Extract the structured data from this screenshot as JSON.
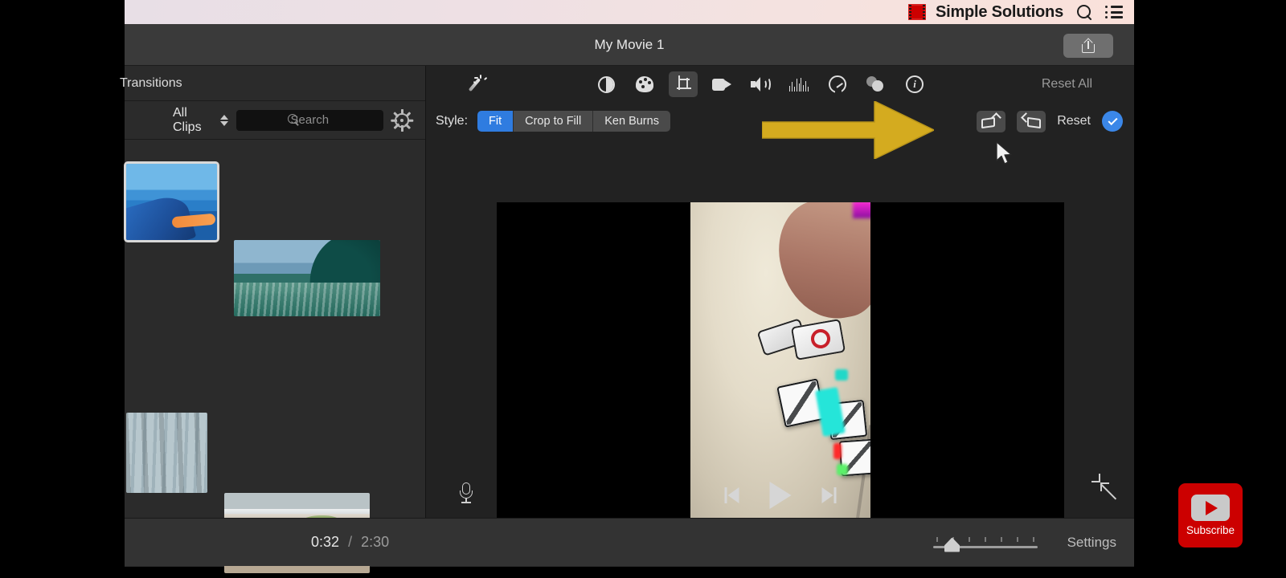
{
  "browser_bar": {
    "brand": "Simple Solutions",
    "logo_icon": "film-strip-icon",
    "search_icon": "search-icon",
    "menu_icon": "list-menu-icon"
  },
  "window": {
    "title": "My Movie 1",
    "share_icon": "share-upload-icon"
  },
  "library": {
    "header_title": "Transitions",
    "filter_label": "All Clips",
    "filter_stepper_icon": "up-down-chevron-icon",
    "search_placeholder": "Search",
    "search_value": "",
    "search_icon": "search-icon",
    "settings_icon": "gear-icon",
    "clips": [
      {
        "name": "clip-kayak",
        "selected": true
      },
      {
        "name": "clip-surf-wave",
        "selected": false
      },
      {
        "name": "clip-water-ripples",
        "selected": false
      },
      {
        "name": "clip-beach-rock",
        "selected": false
      }
    ]
  },
  "inspector": {
    "tools": [
      {
        "name": "enhance-magic-wand",
        "icon": "magic-wand-icon",
        "active": false
      },
      {
        "name": "color-balance",
        "icon": "half-circle-icon",
        "active": false
      },
      {
        "name": "color-correction",
        "icon": "palette-icon",
        "active": false
      },
      {
        "name": "cropping",
        "icon": "crop-icon",
        "active": true
      },
      {
        "name": "stabilization",
        "icon": "video-camera-icon",
        "active": false
      },
      {
        "name": "volume",
        "icon": "speaker-icon",
        "active": false
      },
      {
        "name": "noise-reduction-equalizer",
        "icon": "equalizer-icon",
        "active": false
      },
      {
        "name": "speed",
        "icon": "speedometer-icon",
        "active": false
      },
      {
        "name": "clip-filter",
        "icon": "overlapping-circles-icon",
        "active": false
      },
      {
        "name": "info",
        "icon": "info-circle-icon",
        "active": false
      }
    ],
    "reset_all_label": "Reset All",
    "style_label": "Style:",
    "style_options": [
      {
        "label": "Fit",
        "selected": true
      },
      {
        "label": "Crop to Fill",
        "selected": false
      },
      {
        "label": "Ken Burns",
        "selected": false
      }
    ],
    "rotate_ccw_icon": "rotate-counterclockwise-icon",
    "rotate_cw_icon": "rotate-clockwise-icon",
    "reset_label": "Reset",
    "apply_icon": "checkmark-icon",
    "accent_blue": "#3b87e8",
    "selected_segment_blue": "#2f7ce0"
  },
  "viewer": {
    "mic_icon": "microphone-icon",
    "prev_icon": "skip-to-start-icon",
    "play_icon": "play-icon",
    "next_icon": "skip-to-end-icon",
    "fullscreen_icon": "expand-arrows-icon",
    "content_description": "vertical video of robot toy cubes on a white table"
  },
  "footer": {
    "current_time": "0:32",
    "separator": "/",
    "total_time": "2:30",
    "zoom_slider_value": 12,
    "settings_label": "Settings"
  },
  "overlays": {
    "arrow": {
      "name": "yellow-pointer-arrow",
      "color": "#d4ab1f",
      "direction": "right"
    },
    "cursor": {
      "name": "mouse-cursor"
    },
    "subscribe": {
      "label": "Subscribe",
      "color": "#cc0000",
      "icon": "youtube-play-icon"
    }
  }
}
